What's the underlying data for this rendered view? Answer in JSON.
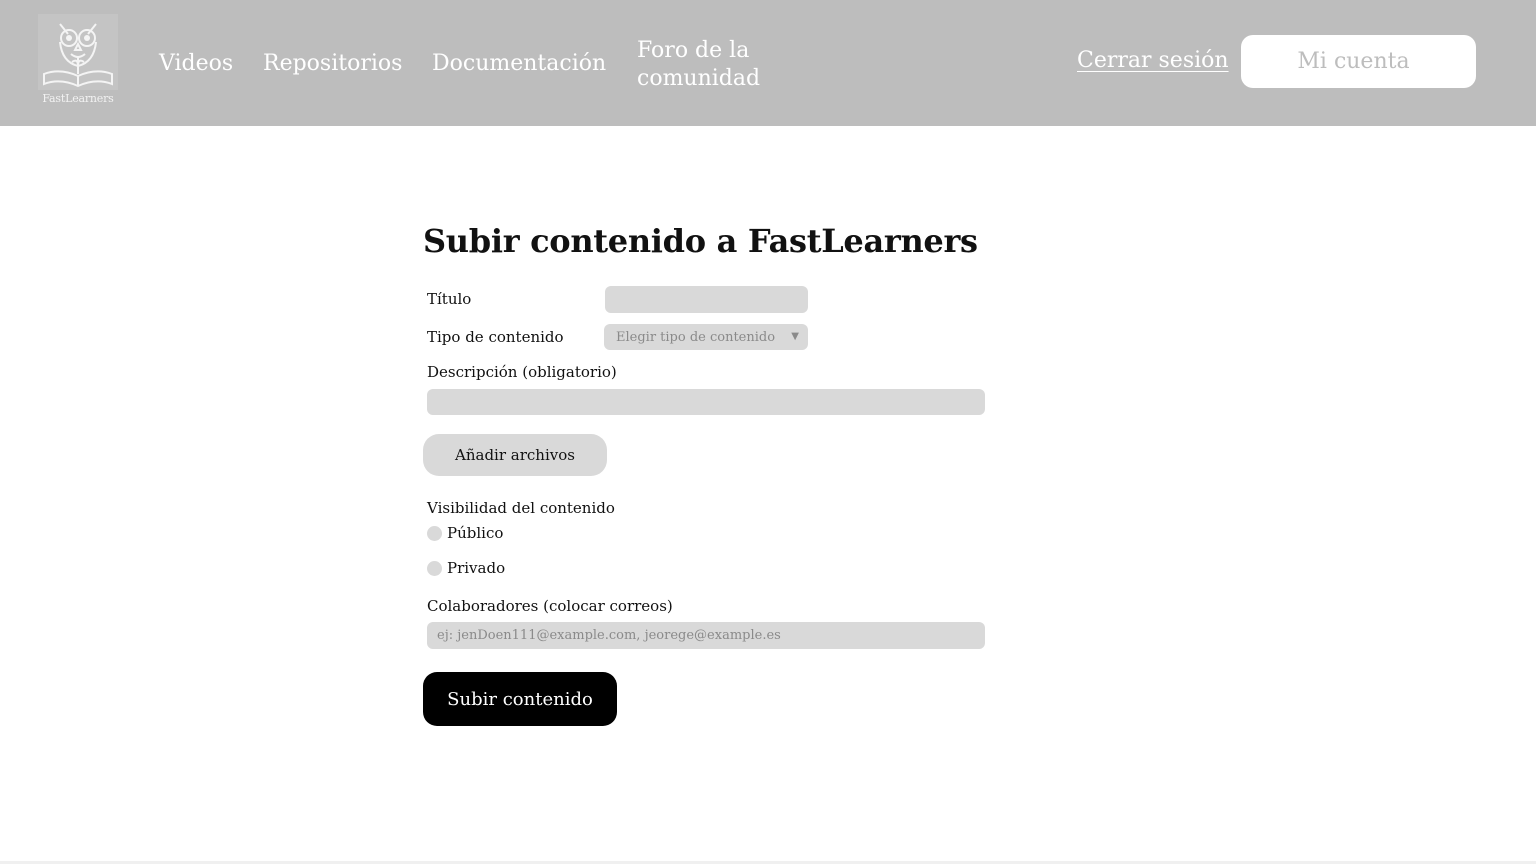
{
  "header": {
    "logo": {
      "text": "FastLearners",
      "icon": "owl-book-logo"
    },
    "nav": [
      {
        "label": "Videos"
      },
      {
        "label": "Repositorios"
      },
      {
        "label": "Documentación"
      },
      {
        "label": "Foro de la comunidad"
      }
    ],
    "logout_label": "Cerrar sesión",
    "account_label": "Mi cuenta"
  },
  "form": {
    "title": "Subir contenido a FastLearners",
    "titulo_label": "Título",
    "titulo_value": "",
    "tipo_label": "Tipo de contenido",
    "tipo_selected": "Elegir tipo de contenido",
    "tipo_icon": "triangle-down-icon",
    "desc_label": "Descripción (obligatorio)",
    "desc_value": "",
    "add_files_label": "Añadir archivos",
    "visibility_label": "Visibilidad del contenido",
    "visibility_options": [
      {
        "label": "Público",
        "checked": false
      },
      {
        "label": "Privado",
        "checked": false
      }
    ],
    "colab_label": "Colaboradores (colocar correos)",
    "colab_placeholder": "ej: jenDoen111@example.com, jeorege@example.es",
    "submit_label": "Subir contenido"
  },
  "colors": {
    "header_bg": "#bdbdbd",
    "input_bg": "#d9d9d9",
    "primary_button": "#000000"
  }
}
